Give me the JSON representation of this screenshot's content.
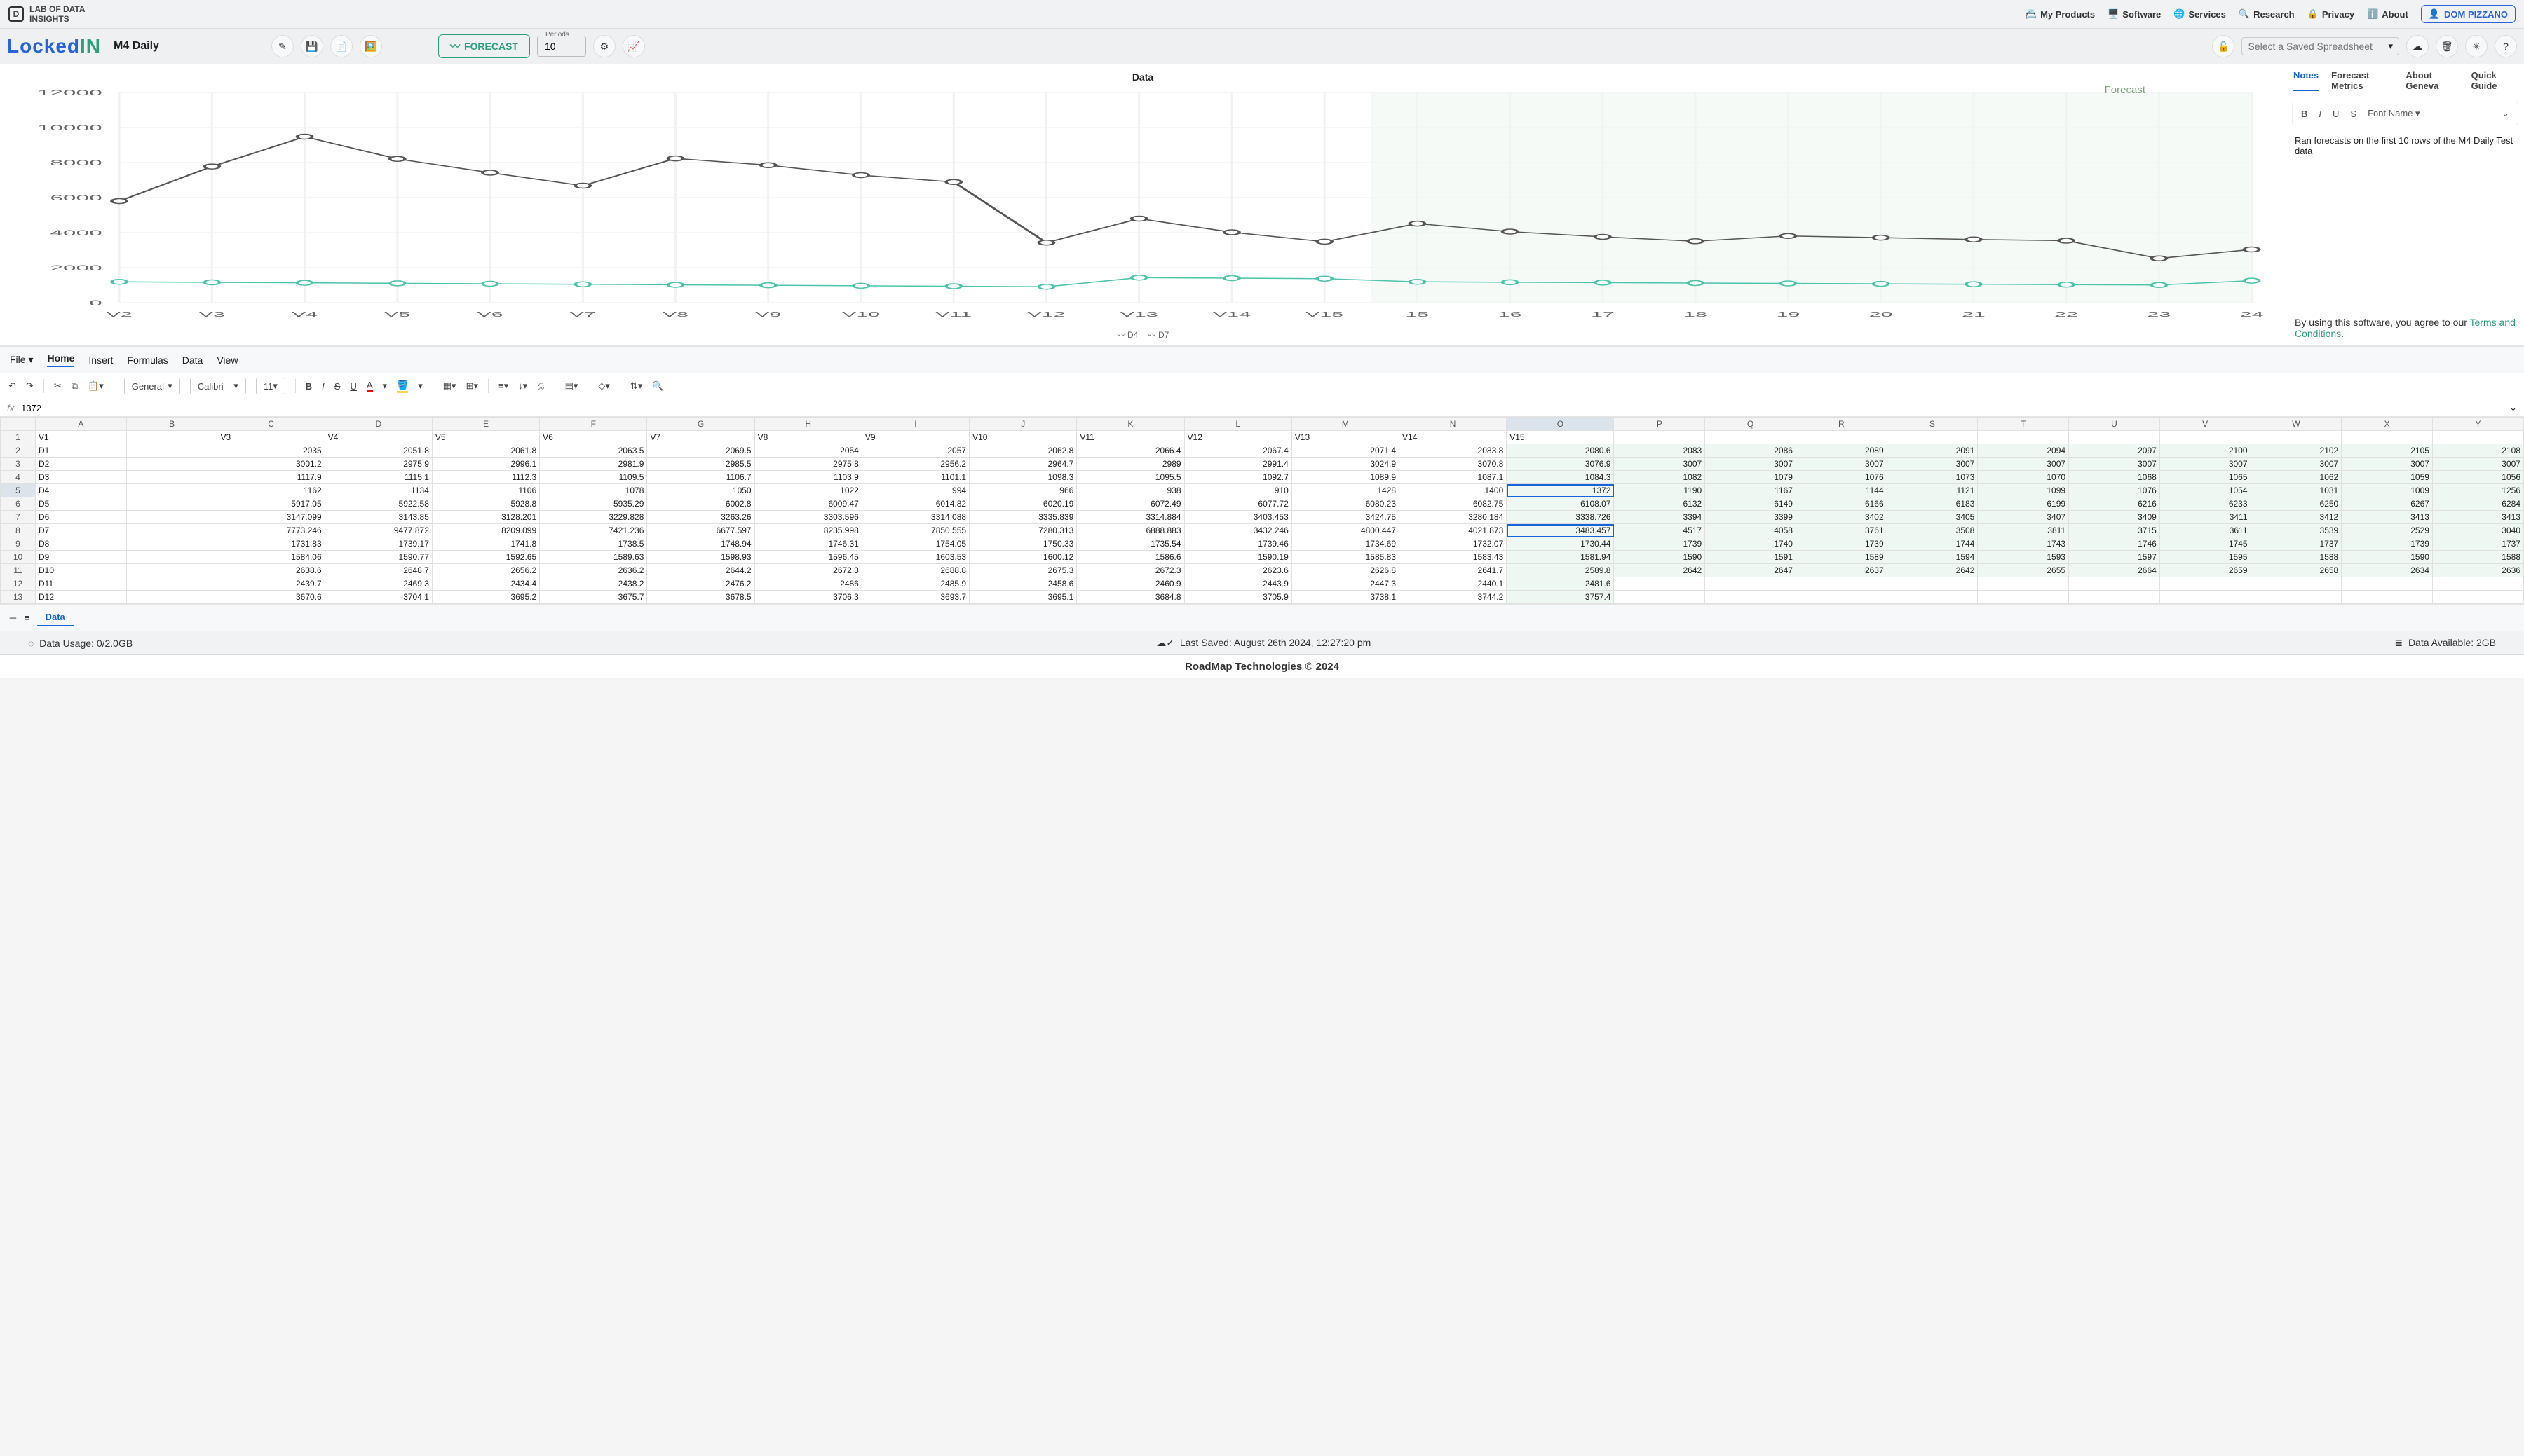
{
  "brand": {
    "line1": "LAB OF DATA",
    "line2": "INSIGHTS"
  },
  "nav": {
    "products": "My Products",
    "software": "Software",
    "services": "Services",
    "research": "Research",
    "privacy": "Privacy",
    "about": "About",
    "user": "DOM PIZZANO"
  },
  "app": {
    "logo1": "Locked",
    "logo2": "IN",
    "docname": "M4 Daily",
    "forecast": "FORECAST",
    "periods_label": "Periods",
    "periods_value": "10",
    "saved_placeholder": "Select a Saved Spreadsheet"
  },
  "chart": {
    "title": "Data",
    "forecast_label": "Forecast",
    "legend1": "D4",
    "legend2": "D7"
  },
  "sidepanel": {
    "tabs": [
      "Notes",
      "Forecast Metrics",
      "About Geneva",
      "Quick Guide"
    ],
    "active_tab": "Notes",
    "font_label": "Font Name",
    "note_text": "Ran forecasts on the first 10 rows of the M4 Daily Test data",
    "terms_prefix": "By using this software, you agree to our ",
    "terms_link": "Terms and Conditions"
  },
  "menubar": {
    "file": "File",
    "home": "Home",
    "insert": "Insert",
    "formulas": "Formulas",
    "data": "Data",
    "view": "View"
  },
  "sstoolbar": {
    "format": "General",
    "font": "Calibri",
    "size": "11"
  },
  "fx_value": "1372",
  "col_letters": [
    "A",
    "B",
    "C",
    "D",
    "E",
    "F",
    "G",
    "H",
    "I",
    "J",
    "K",
    "L",
    "M",
    "N",
    "O",
    "P",
    "Q",
    "R",
    "S",
    "T",
    "U",
    "V",
    "W",
    "X",
    "Y"
  ],
  "headers_row": [
    "V1",
    "",
    "V3",
    "V4",
    "V5",
    "V6",
    "V7",
    "V8",
    "V9",
    "V10",
    "V11",
    "V12",
    "V13",
    "V14",
    "V15",
    "",
    "",
    "",
    "",
    "",
    "",
    "",
    "",
    "",
    ""
  ],
  "forecast_start_col": 15,
  "selected_cell": {
    "row": 5,
    "col": 14
  },
  "secondary_sel": {
    "row": 8,
    "col": 14
  },
  "rows": [
    {
      "n": 2,
      "lbl": "D1",
      "v": [
        "",
        "2035",
        "2051.8",
        "2061.8",
        "2063.5",
        "2069.5",
        "2054",
        "2057",
        "2062.8",
        "2066.4",
        "2067.4",
        "2071.4",
        "2083.8",
        "2080.6",
        "2083",
        "2086",
        "2089",
        "2091",
        "2094",
        "2097",
        "2100",
        "2102",
        "2105",
        "2108"
      ]
    },
    {
      "n": 3,
      "lbl": "D2",
      "v": [
        "",
        "3001.2",
        "2975.9",
        "2996.1",
        "2981.9",
        "2985.5",
        "2975.8",
        "2956.2",
        "2964.7",
        "2989",
        "2991.4",
        "3024.9",
        "3070.8",
        "3076.9",
        "3007",
        "3007",
        "3007",
        "3007",
        "3007",
        "3007",
        "3007",
        "3007",
        "3007",
        "3007"
      ]
    },
    {
      "n": 4,
      "lbl": "D3",
      "v": [
        "",
        "1117.9",
        "1115.1",
        "1112.3",
        "1109.5",
        "1106.7",
        "1103.9",
        "1101.1",
        "1098.3",
        "1095.5",
        "1092.7",
        "1089.9",
        "1087.1",
        "1084.3",
        "1082",
        "1079",
        "1076",
        "1073",
        "1070",
        "1068",
        "1065",
        "1062",
        "1059",
        "1056"
      ]
    },
    {
      "n": 5,
      "lbl": "D4",
      "v": [
        "",
        "1162",
        "1134",
        "1106",
        "1078",
        "1050",
        "1022",
        "994",
        "966",
        "938",
        "910",
        "1428",
        "1400",
        "1372",
        "1190",
        "1167",
        "1144",
        "1121",
        "1099",
        "1076",
        "1054",
        "1031",
        "1009",
        "1256"
      ]
    },
    {
      "n": 6,
      "lbl": "D5",
      "v": [
        "",
        "5917.05",
        "5922.58",
        "5928.8",
        "5935.29",
        "6002.8",
        "6009.47",
        "6014.82",
        "6020.19",
        "6072.49",
        "6077.72",
        "6080.23",
        "6082.75",
        "6108.07",
        "6132",
        "6149",
        "6166",
        "6183",
        "6199",
        "6216",
        "6233",
        "6250",
        "6267",
        "6284"
      ]
    },
    {
      "n": 7,
      "lbl": "D6",
      "v": [
        "",
        "3147.099",
        "3143.85",
        "3128.201",
        "3229.828",
        "3263.26",
        "3303.596",
        "3314.088",
        "3335.839",
        "3314.884",
        "3403.453",
        "3424.75",
        "3280.184",
        "3338.726",
        "3394",
        "3399",
        "3402",
        "3405",
        "3407",
        "3409",
        "3411",
        "3412",
        "3413",
        "3413"
      ]
    },
    {
      "n": 8,
      "lbl": "D7",
      "v": [
        "",
        "7773.246",
        "9477.872",
        "8209.099",
        "7421.236",
        "6677.597",
        "8235.998",
        "7850.555",
        "7280.313",
        "6888.883",
        "3432.246",
        "4800.447",
        "4021.873",
        "3483.457",
        "4517",
        "4058",
        "3761",
        "3508",
        "3811",
        "3715",
        "3611",
        "3539",
        "2529",
        "3040"
      ]
    },
    {
      "n": 9,
      "lbl": "D8",
      "v": [
        "",
        "1731.83",
        "1739.17",
        "1741.8",
        "1738.5",
        "1748.94",
        "1746.31",
        "1754.05",
        "1750.33",
        "1735.54",
        "1739.46",
        "1734.69",
        "1732.07",
        "1730.44",
        "1739",
        "1740",
        "1739",
        "1744",
        "1743",
        "1746",
        "1745",
        "1737",
        "1739",
        "1737"
      ]
    },
    {
      "n": 10,
      "lbl": "D9",
      "v": [
        "",
        "1584.06",
        "1590.77",
        "1592.65",
        "1589.63",
        "1598.93",
        "1596.45",
        "1603.53",
        "1600.12",
        "1586.6",
        "1590.19",
        "1585.83",
        "1583.43",
        "1581.94",
        "1590",
        "1591",
        "1589",
        "1594",
        "1593",
        "1597",
        "1595",
        "1588",
        "1590",
        "1588"
      ]
    },
    {
      "n": 11,
      "lbl": "D10",
      "v": [
        "",
        "2638.6",
        "2648.7",
        "2656.2",
        "2636.2",
        "2644.2",
        "2672.3",
        "2688.8",
        "2675.3",
        "2672.3",
        "2623.6",
        "2626.8",
        "2641.7",
        "2589.8",
        "2642",
        "2647",
        "2637",
        "2642",
        "2655",
        "2664",
        "2659",
        "2658",
        "2634",
        "2636"
      ]
    },
    {
      "n": 12,
      "lbl": "D11",
      "v": [
        "",
        "2439.7",
        "2469.3",
        "2434.4",
        "2438.2",
        "2476.2",
        "2486",
        "2485.9",
        "2458.6",
        "2460.9",
        "2443.9",
        "2447.3",
        "2440.1",
        "2481.6",
        "",
        "",
        "",
        "",
        "",
        "",
        "",
        "",
        "",
        ""
      ]
    },
    {
      "n": 13,
      "lbl": "D12",
      "v": [
        "",
        "3670.6",
        "3704.1",
        "3695.2",
        "3675.7",
        "3678.5",
        "3706.3",
        "3693.7",
        "3695.1",
        "3684.8",
        "3705.9",
        "3738.1",
        "3744.2",
        "3757.4",
        "",
        "",
        "",
        "",
        "",
        "",
        "",
        "",
        "",
        ""
      ]
    }
  ],
  "sheet_tabs": [
    "Data"
  ],
  "status": {
    "usage": "Data Usage: 0/2.0GB",
    "saved": "Last Saved: August 26th 2024, 12:27:20 pm",
    "avail": "Data Available: 2GB"
  },
  "footer": "RoadMap Technologies © 2024",
  "chart_data": {
    "type": "line",
    "title": "Data",
    "ylim": [
      0,
      12000
    ],
    "yticks": [
      0,
      2000,
      4000,
      6000,
      8000,
      10000,
      12000
    ],
    "x_labels": [
      "V2",
      "V3",
      "V4",
      "V5",
      "V6",
      "V7",
      "V8",
      "V9",
      "V10",
      "V11",
      "V12",
      "V13",
      "V14",
      "V15",
      "15",
      "16",
      "17",
      "18",
      "19",
      "20",
      "21",
      "22",
      "23",
      "24"
    ],
    "forecast_start_index": 14,
    "series": [
      {
        "name": "D7",
        "color": "#555",
        "values": [
          5800,
          7773,
          9478,
          8209,
          7421,
          6678,
          8236,
          7851,
          7280,
          6889,
          3432,
          4800,
          4022,
          3483,
          4517,
          4058,
          3761,
          3508,
          3811,
          3715,
          3611,
          3539,
          2529,
          3040
        ]
      },
      {
        "name": "D4",
        "color": "#4cc4aa",
        "values": [
          1190,
          1162,
          1134,
          1106,
          1078,
          1050,
          1022,
          994,
          966,
          938,
          910,
          1428,
          1400,
          1372,
          1190,
          1167,
          1144,
          1121,
          1099,
          1076,
          1054,
          1031,
          1009,
          1256
        ]
      }
    ]
  }
}
